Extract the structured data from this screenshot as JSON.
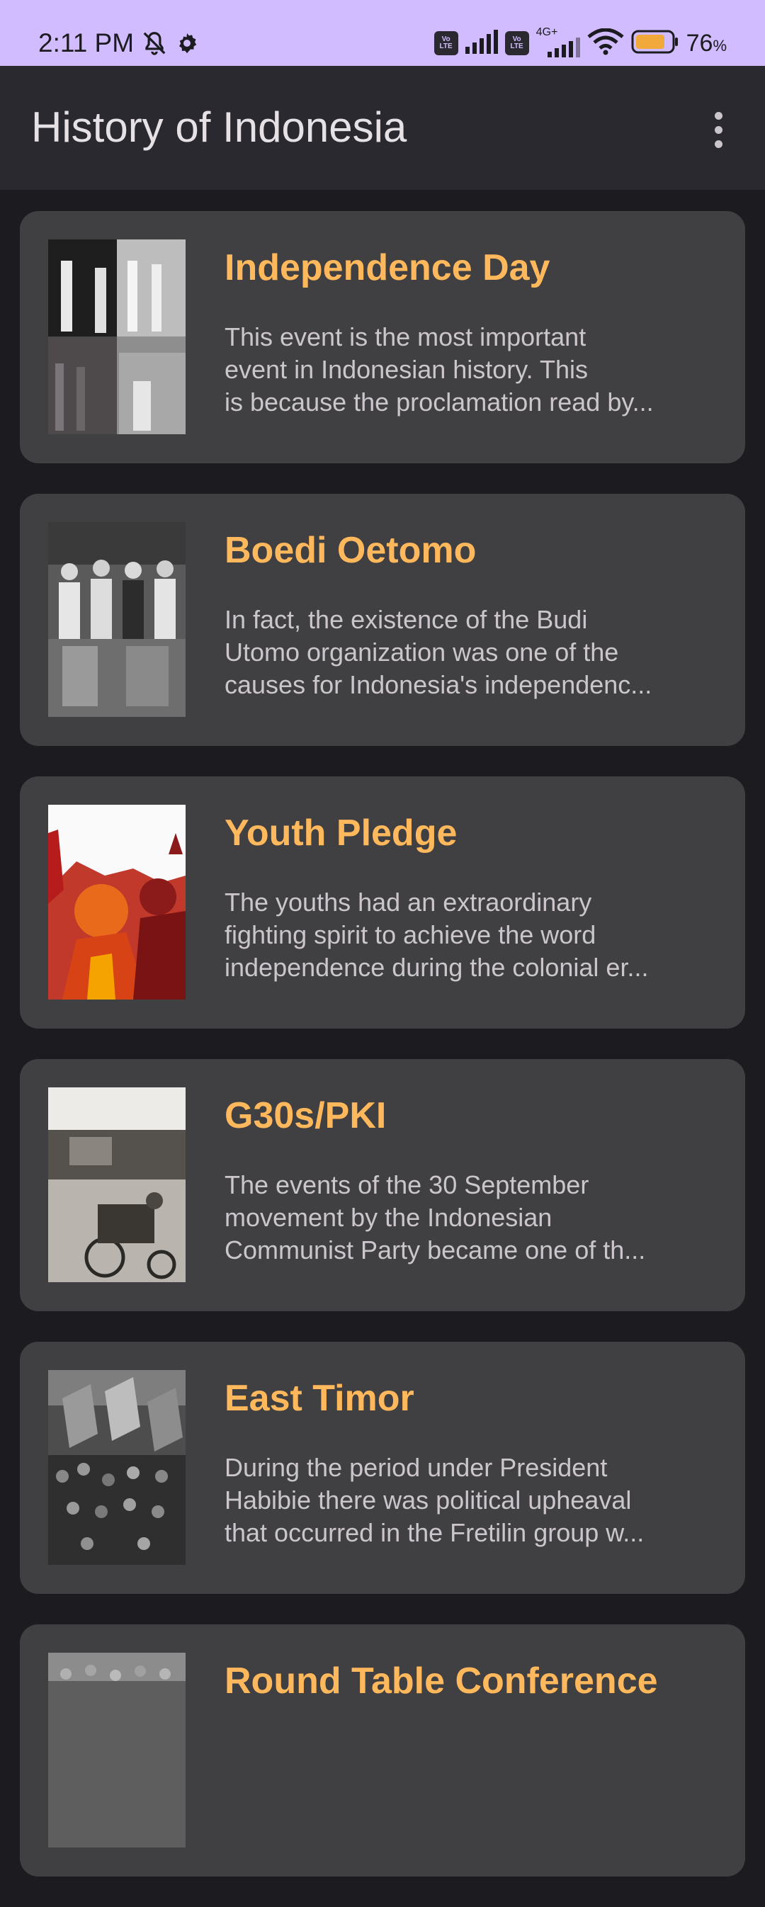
{
  "status_bar": {
    "time": "2:11 PM",
    "network": "4G+",
    "volte_label_top": "Vo",
    "volte_label_bottom": "LTE",
    "battery": "76",
    "battery_unit": "%"
  },
  "app_bar": {
    "title": "History of Indonesia",
    "menu_icon": "more-vertical-icon"
  },
  "colors": {
    "status_bar": "#d0bcff",
    "app_bar": "#2b2930",
    "background": "#1c1b1f",
    "card": "#403f41",
    "title_accent": "#ffb95c",
    "body_text": "#cbc6cc"
  },
  "events": [
    {
      "title": "Independence Day",
      "desc_lines": [
        "This event is the most important",
        "event in Indonesian history. This",
        "is because the proclamation read by..."
      ]
    },
    {
      "title": "Boedi Oetomo",
      "desc_lines": [
        "In fact, the existence of the Budi",
        "Utomo organization was one of the",
        "causes for Indonesia's independenc..."
      ]
    },
    {
      "title": "Youth Pledge",
      "desc_lines": [
        "The youths had an extraordinary",
        "fighting spirit to achieve the word",
        "independence during the colonial er..."
      ]
    },
    {
      "title": "G30s/PKI",
      "desc_lines": [
        "The events of the 30 September",
        "movement by the Indonesian",
        "Communist Party became one of th..."
      ]
    },
    {
      "title": "East Timor",
      "desc_lines": [
        "During the period under President",
        "Habibie there was political upheaval",
        "that occurred in the Fretilin group w..."
      ]
    },
    {
      "title": "Round Table Conference",
      "desc_lines": []
    }
  ]
}
